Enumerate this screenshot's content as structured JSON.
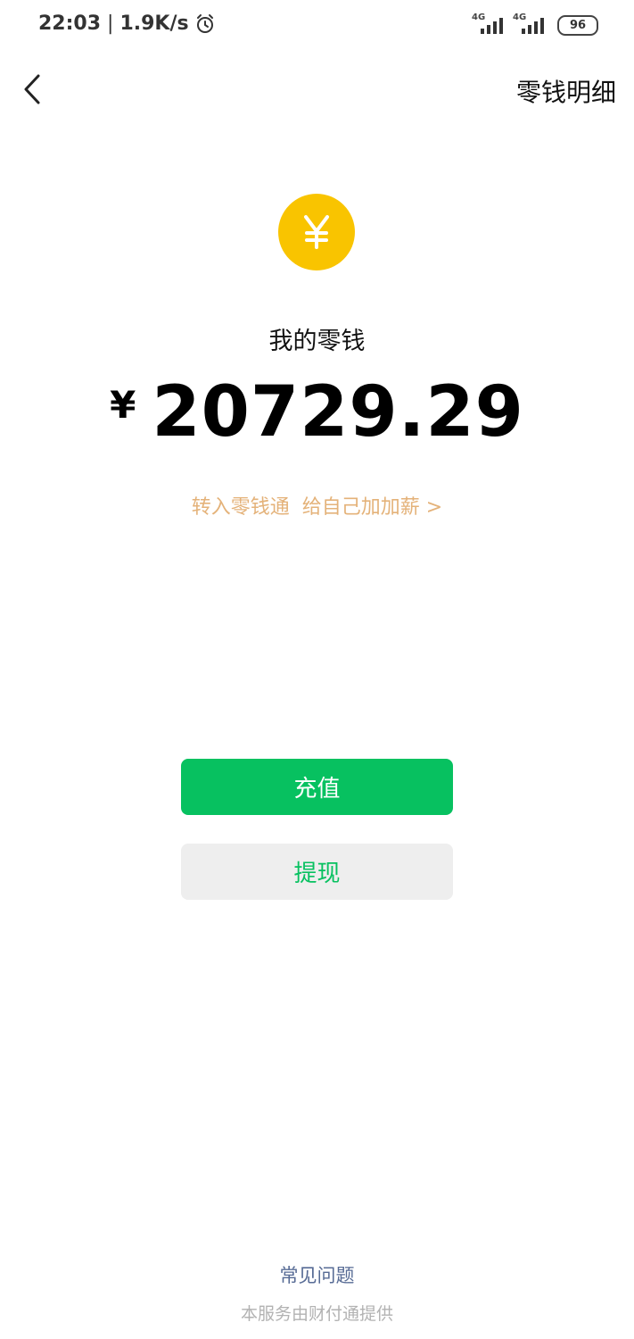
{
  "status_bar": {
    "time": "22:03",
    "separator": "|",
    "net_speed": "1.9K/s",
    "signal_label_1": "4G",
    "signal_label_2": "4G",
    "battery": "96"
  },
  "header": {
    "back_icon": "chevron-left-icon",
    "detail_link": "零钱明细"
  },
  "wallet": {
    "coin_icon": "yuan-coin-icon",
    "coin_color": "#f9c400",
    "title": "我的零钱",
    "currency_symbol": "¥",
    "amount": "20729.29",
    "promo_text": "转入零钱通  给自己加加薪 >"
  },
  "actions": {
    "recharge_label": "充值",
    "withdraw_label": "提现",
    "primary_color": "#07c160"
  },
  "footer": {
    "faq_link": "常见问题",
    "provider_note": "本服务由财付通提供"
  }
}
